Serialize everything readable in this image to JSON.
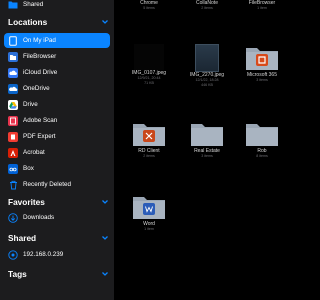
{
  "sidebar": {
    "top_item": "Shared",
    "locations_title": "Locations",
    "locations": [
      {
        "label": "On My iPad",
        "icon": "ipad-icon",
        "active": true
      },
      {
        "label": "FileBrowser",
        "icon": "filebrowser-icon"
      },
      {
        "label": "iCloud Drive",
        "icon": "icloud-icon"
      },
      {
        "label": "OneDrive",
        "icon": "onedrive-icon"
      },
      {
        "label": "Drive",
        "icon": "google-drive-icon"
      },
      {
        "label": "Adobe Scan",
        "icon": "adobe-scan-icon"
      },
      {
        "label": "PDF Expert",
        "icon": "pdf-expert-icon"
      },
      {
        "label": "Acrobat",
        "icon": "acrobat-icon"
      },
      {
        "label": "Box",
        "icon": "box-icon"
      },
      {
        "label": "Recently Deleted",
        "icon": "trash-icon"
      }
    ],
    "favorites_title": "Favorites",
    "favorites": [
      {
        "label": "Downloads",
        "icon": "download-icon"
      }
    ],
    "shared_title": "Shared",
    "shared": [
      {
        "label": "192.168.0.239",
        "icon": "server-icon"
      }
    ],
    "tags_title": "Tags"
  },
  "main": {
    "row1": [
      {
        "name": "Chrome",
        "sub": "5 items"
      },
      {
        "name": "CollaNote",
        "sub": "2 items"
      },
      {
        "name": "FileBrowser",
        "sub": "1 item"
      }
    ],
    "row2": [
      {
        "name": "IMG_0107.jpeg",
        "sub1": "12/9/21, 20:44",
        "sub2": "71 KB"
      },
      {
        "name": "IMG_2270.jpeg",
        "sub1": "12/1/22, 18:28",
        "sub2": "446 KB"
      },
      {
        "name": "Microsoft 365",
        "sub": "3 items"
      }
    ],
    "row3": [
      {
        "name": "RD Client",
        "sub": "2 items"
      },
      {
        "name": "Real Estate",
        "sub": "3 items"
      },
      {
        "name": "Rob",
        "sub": "8 items"
      }
    ],
    "row4": [
      {
        "name": "Word",
        "sub": "1 item"
      }
    ]
  },
  "colors": {
    "accent": "#0a84ff",
    "folder": "#9aa6b4",
    "sidebar_bg": "#1c1c1e"
  }
}
